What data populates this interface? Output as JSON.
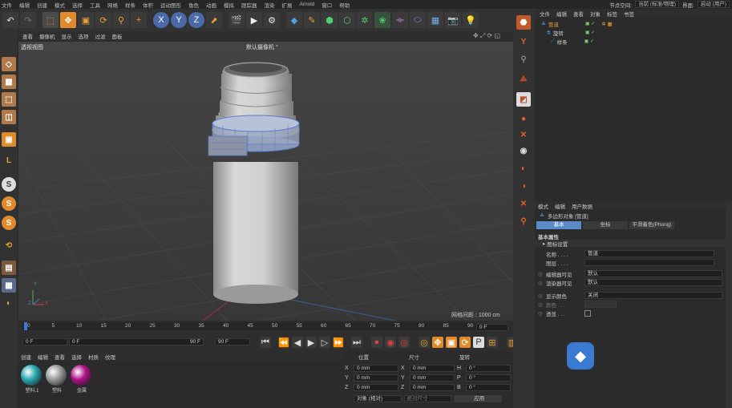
{
  "menu": [
    "文件",
    "编辑",
    "创建",
    "模式",
    "选择",
    "工具",
    "网格",
    "样条",
    "体积",
    "运动图形",
    "角色",
    "动画",
    "模拟",
    "跟踪器",
    "渲染",
    "扩展",
    "Arnold",
    "窗口",
    "帮助"
  ],
  "top_right": {
    "node_space_label": "节点空间:",
    "node_space_value": "当前 (标准/物理)",
    "layout_label": "界面:",
    "layout_value": "启动 (用户)"
  },
  "view_menu": [
    "查看",
    "摄像机",
    "显示",
    "选项",
    "过滤",
    "面板"
  ],
  "viewport": {
    "label": "透视视图",
    "camera": "默认摄像机 °",
    "grid_spacing": "网格间距 : 1000 cm",
    "axis_x": "X",
    "axis_y": "Y",
    "axis_z": "Z"
  },
  "timeline": {
    "ticks": [
      "0",
      "5",
      "10",
      "15",
      "20",
      "25",
      "30",
      "35",
      "40",
      "45",
      "50",
      "55",
      "60",
      "65",
      "70",
      "75",
      "80",
      "85",
      "90"
    ],
    "current_frame": "0 F",
    "start": "0 F",
    "min": "0 F",
    "max": "90 F",
    "end": "90 F"
  },
  "material_menu": [
    "创建",
    "编辑",
    "查看",
    "选择",
    "材质",
    "纹理"
  ],
  "materials": [
    {
      "name": "塑料.1",
      "color": "#2aa8b0"
    },
    {
      "name": "塑料",
      "color": "#9a9a9a"
    },
    {
      "name": "金属",
      "color": "#b0128a"
    }
  ],
  "coords": {
    "col1": "位置",
    "col2": "尺寸",
    "col3": "旋转",
    "rows": [
      {
        "a": "X",
        "v1": "0 mm",
        "b": "X",
        "v2": "0 mm",
        "c": "H",
        "v3": "0 °"
      },
      {
        "a": "Y",
        "v1": "0 mm",
        "b": "Y",
        "v2": "0 mm",
        "c": "P",
        "v3": "0 °"
      },
      {
        "a": "Z",
        "v1": "0 mm",
        "b": "Z",
        "v2": "0 mm",
        "c": "B",
        "v3": "0 °"
      }
    ],
    "mode": "对象 (相对)",
    "size_mode": "绝对尺寸",
    "apply": "应用"
  },
  "object_manager": {
    "menu": [
      "文件",
      "编辑",
      "查看",
      "对象",
      "标签",
      "书签"
    ],
    "items": [
      {
        "name": "管道",
        "color": "#e0a030"
      },
      {
        "name": "旋转",
        "color": "#c8c8c8"
      },
      {
        "name": "样条",
        "color": "#c8c8c8"
      }
    ]
  },
  "attributes": {
    "menu": [
      "模式",
      "编辑",
      "用户数据"
    ],
    "object": "多边形对象 [管道]",
    "tabs": [
      "基本",
      "坐标",
      "平滑着色(Phong)"
    ],
    "section": "基本属性",
    "subsection": "图标设置",
    "fields": [
      {
        "label": "名称 . . . .",
        "value": "管道"
      },
      {
        "label": "图层 . . . .",
        "value": ""
      }
    ],
    "editor_visible_label": "编辑器可见",
    "editor_visible": "默认",
    "render_visible_label": "渲染器可见",
    "render_visible": "默认",
    "display_color_label": "显示颜色",
    "display_color": "关闭",
    "color_label": "颜色 . . .",
    "transparent_label": "透显 . . ."
  }
}
